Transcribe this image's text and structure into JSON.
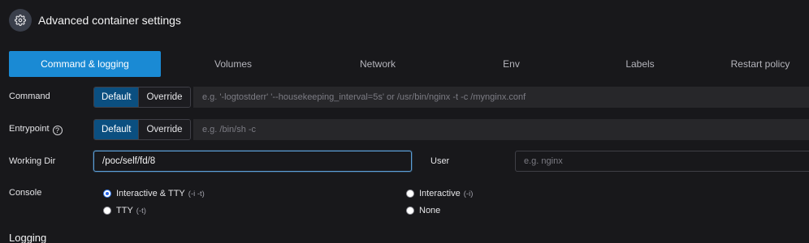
{
  "header": {
    "title": "Advanced container settings",
    "icon": "gear-icon"
  },
  "tabs": [
    {
      "label": "Command & logging",
      "active": true
    },
    {
      "label": "Volumes",
      "active": false
    },
    {
      "label": "Network",
      "active": false
    },
    {
      "label": "Env",
      "active": false
    },
    {
      "label": "Labels",
      "active": false
    },
    {
      "label": "Restart policy",
      "active": false
    }
  ],
  "command": {
    "label": "Command",
    "default_label": "Default",
    "override_label": "Override",
    "placeholder": "e.g. '-logtostderr' '--housekeeping_interval=5s' or /usr/bin/nginx -t -c /mynginx.conf"
  },
  "entrypoint": {
    "label": "Entrypoint",
    "help": "?",
    "default_label": "Default",
    "override_label": "Override",
    "placeholder": "e.g. /bin/sh -c"
  },
  "working_dir": {
    "label": "Working Dir",
    "value": "/poc/self/fd/8"
  },
  "user": {
    "label": "User",
    "placeholder": "e.g. nginx"
  },
  "console": {
    "label": "Console",
    "options": [
      {
        "label": "Interactive & TTY",
        "hint": "(-i -t)",
        "checked": true
      },
      {
        "label": "Interactive",
        "hint": "(-i)",
        "checked": false
      },
      {
        "label": "TTY",
        "hint": "(-t)",
        "checked": false
      },
      {
        "label": "None",
        "hint": "",
        "checked": false
      }
    ]
  },
  "logging": {
    "title": "Logging"
  },
  "colors": {
    "accent": "#1a8ad4",
    "active_segment": "#0b4f80",
    "background": "#18181b"
  }
}
